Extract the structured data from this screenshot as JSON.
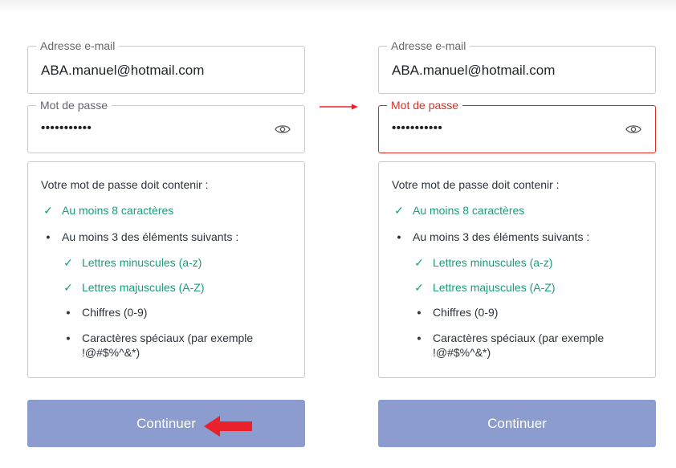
{
  "colors": {
    "accent": "#8d9cce",
    "success": "#1a9d78",
    "error": "#d93025",
    "annotation": "#e8212a"
  },
  "left": {
    "email_label": "Adresse e-mail",
    "email_value": "ABA.manuel@hotmail.com",
    "password_label": "Mot de passe",
    "password_value": "•••••••••••",
    "rules_title": "Votre mot de passe doit contenir :",
    "rules": [
      {
        "text": "Au moins 8 caractères",
        "met": true,
        "mark": "✓"
      },
      {
        "text": "Au moins 3 des éléments suivants :",
        "met": false,
        "mark": "•"
      },
      {
        "text": "Lettres minuscules (a-z)",
        "met": true,
        "mark": "✓"
      },
      {
        "text": "Lettres majuscules (A-Z)",
        "met": true,
        "mark": "✓"
      },
      {
        "text": "Chiffres (0-9)",
        "met": false,
        "mark": "•"
      },
      {
        "text": "Caractères spéciaux (par exemple",
        "text2": "!@#$%^&*)",
        "met": false,
        "mark": "•"
      }
    ],
    "button_label": "Continuer"
  },
  "right": {
    "email_label": "Adresse e-mail",
    "email_value": "ABA.manuel@hotmail.com",
    "password_label": "Mot de passe",
    "password_value": "•••••••••••",
    "rules_title": "Votre mot de passe doit contenir :",
    "rules": [
      {
        "text": "Au moins 8 caractères",
        "met": true,
        "mark": "✓"
      },
      {
        "text": "Au moins 3 des éléments suivants :",
        "met": false,
        "mark": "•"
      },
      {
        "text": "Lettres minuscules (a-z)",
        "met": true,
        "mark": "✓"
      },
      {
        "text": "Lettres majuscules (A-Z)",
        "met": true,
        "mark": "✓"
      },
      {
        "text": "Chiffres (0-9)",
        "met": false,
        "mark": "•"
      },
      {
        "text": "Caractères spéciaux (par exemple",
        "text2": "!@#$%^&*)",
        "met": false,
        "mark": "•"
      }
    ],
    "button_label": "Continuer"
  },
  "icons": {
    "eye": "eye-icon",
    "arrow_small": "arrow-right-icon",
    "arrow_big": "arrow-left-icon"
  }
}
